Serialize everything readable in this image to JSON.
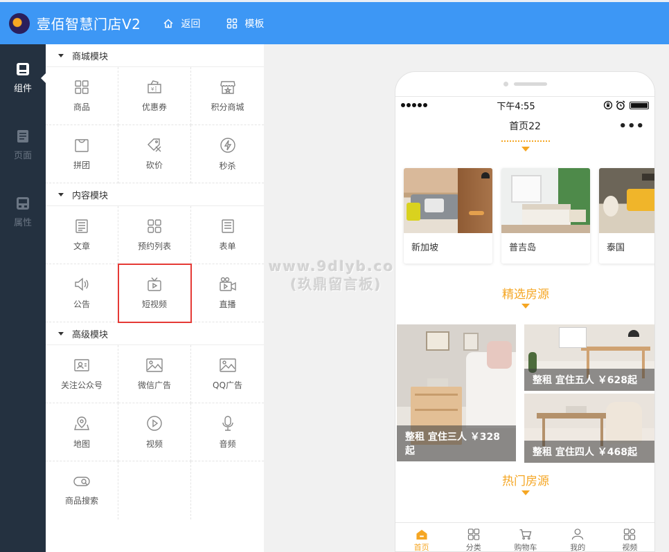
{
  "header": {
    "title": "壹佰智慧门店V2",
    "nav": [
      {
        "label": "返回",
        "icon": "home-icon"
      },
      {
        "label": "模板",
        "icon": "grid-icon"
      }
    ]
  },
  "sidebar": {
    "items": [
      {
        "label": "组件",
        "icon": "component-icon",
        "active": true
      },
      {
        "label": "页面",
        "icon": "page-icon",
        "active": false
      },
      {
        "label": "属性",
        "icon": "property-icon",
        "active": false
      }
    ]
  },
  "panel": {
    "sections": [
      {
        "title": "商城模块",
        "items": [
          {
            "label": "商品",
            "icon": "goods-icon"
          },
          {
            "label": "优惠券",
            "icon": "coupon-icon"
          },
          {
            "label": "积分商城",
            "icon": "points-mall-icon"
          },
          {
            "label": "拼团",
            "icon": "group-buy-icon"
          },
          {
            "label": "砍价",
            "icon": "bargain-icon"
          },
          {
            "label": "秒杀",
            "icon": "flash-sale-icon"
          }
        ]
      },
      {
        "title": "内容模块",
        "items": [
          {
            "label": "文章",
            "icon": "article-icon"
          },
          {
            "label": "预约列表",
            "icon": "booking-list-icon"
          },
          {
            "label": "表单",
            "icon": "form-icon"
          },
          {
            "label": "公告",
            "icon": "announcement-icon"
          },
          {
            "label": "短视频",
            "icon": "short-video-icon",
            "highlighted": true
          },
          {
            "label": "直播",
            "icon": "live-icon"
          }
        ]
      },
      {
        "title": "高级模块",
        "items": [
          {
            "label": "关注公众号",
            "icon": "follow-account-icon"
          },
          {
            "label": "微信广告",
            "icon": "wechat-ad-icon"
          },
          {
            "label": "QQ广告",
            "icon": "qq-ad-icon"
          },
          {
            "label": "地图",
            "icon": "map-icon"
          },
          {
            "label": "视频",
            "icon": "video-icon"
          },
          {
            "label": "音频",
            "icon": "audio-icon"
          },
          {
            "label": "商品搜索",
            "icon": "goods-search-icon"
          }
        ]
      }
    ]
  },
  "watermark": {
    "line1": "www.9dlyb.com",
    "line2": "(玖鼎留言板)"
  },
  "phone": {
    "status": {
      "time": "下午4:55"
    },
    "page_title": "首页22",
    "more": "•••",
    "cities": [
      {
        "name": "新加坡"
      },
      {
        "name": "普吉岛"
      },
      {
        "name": "泰国"
      }
    ],
    "sections": {
      "featured_title": "精选房源",
      "hot_title": "热门房源"
    },
    "rooms": [
      {
        "caption": "整租 宜住三人 ￥328起"
      },
      {
        "caption": "整租 宜住五人 ￥628起"
      },
      {
        "caption": "整租 宜住四人 ￥468起"
      }
    ],
    "tabs": [
      {
        "label": "首页",
        "active": true,
        "icon": "home-tab-icon"
      },
      {
        "label": "分类",
        "active": false,
        "icon": "category-tab-icon"
      },
      {
        "label": "购物车",
        "active": false,
        "icon": "cart-tab-icon"
      },
      {
        "label": "我的",
        "active": false,
        "icon": "profile-tab-icon"
      },
      {
        "label": "视频",
        "active": false,
        "icon": "video-tab-icon"
      }
    ]
  },
  "colors": {
    "topbar": "#3d97f5",
    "sidebar": "#243140",
    "accent": "#f5a623",
    "highlight_border": "#e53935"
  }
}
